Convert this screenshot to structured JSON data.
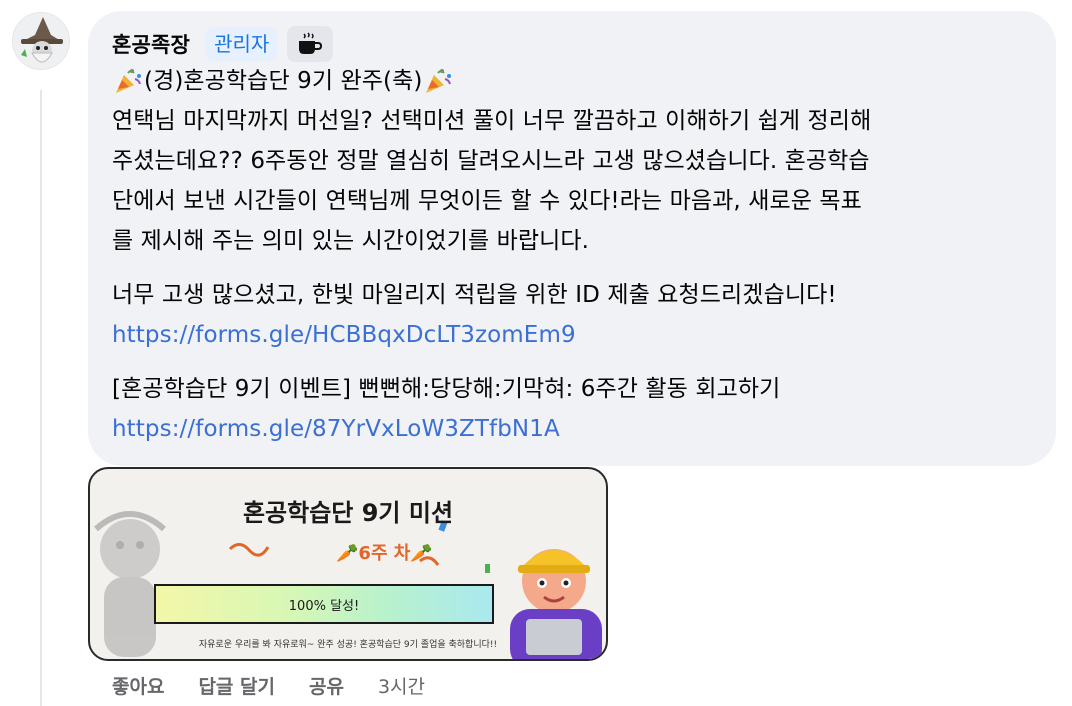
{
  "comment": {
    "author": "혼공족장",
    "role_badge": "관리자",
    "title": "(경)혼공학습단 9기 완주(축)",
    "paragraph1_lines": [
      "연택님 마지막까지 머선일? 선택미션 풀이 너무 깔끔하고 이해하기 쉽게 정리해",
      "주셨는데요?? 6주동안 정말 열심히 달려오시느라 고생 많으셨습니다. 혼공학습",
      "단에서 보낸 시간들이 연택님께 무엇이든 할 수 있다!라는 마음과, 새로운 목표",
      "를 제시해 주는 의미 있는 시간이었기를 바랍니다."
    ],
    "paragraph2_text": "너무 고생 많으셨고, 한빛 마일리지 적립을 위한 ID 제출 요청드리겠습니다!",
    "paragraph2_link": "https://forms.gle/HCBBqxDcLT3zomEm9",
    "paragraph3_text": "[혼공학습단 9기 이벤트] 뻔뻔해:당당해:기막혀: 6주간 활동 회고하기",
    "paragraph3_link": "https://forms.gle/87YrVxLoW3ZTfbN1A"
  },
  "attachment": {
    "title": "혼공학습단 9기 미션",
    "week_label": "6주 차",
    "progress_label": "100% 달성!",
    "progress_value": 1.0,
    "caption": "자유로운 우리를 봐 자유로워~ 완주 성공! 혼공학습단 9기 졸업을 축하합니다!!"
  },
  "actions": {
    "like": "좋아요",
    "reply": "답글 달기",
    "share": "공유",
    "time": "3시간"
  },
  "colors": {
    "bubble": "#f0f2f5",
    "link": "#3b6fd4",
    "badge_text": "#1b74e4",
    "muted": "#65676b"
  }
}
